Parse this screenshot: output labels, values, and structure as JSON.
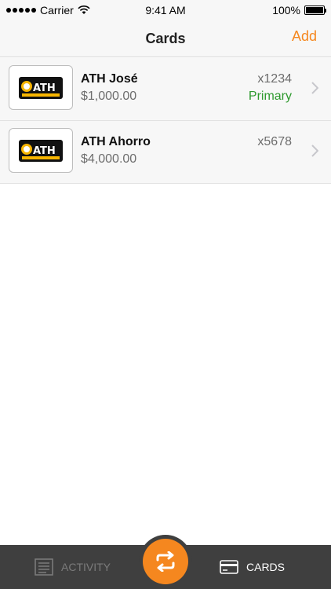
{
  "status_bar": {
    "carrier": "Carrier",
    "time": "9:41 AM",
    "battery": "100%"
  },
  "nav": {
    "title": "Cards",
    "add_label": "Add"
  },
  "cards": [
    {
      "logo_text": "ATH",
      "name": "ATH José",
      "amount": "$1,000.00",
      "number": "x1234",
      "tag": "Primary"
    },
    {
      "logo_text": "ATH",
      "name": "ATH Ahorro",
      "amount": "$4,000.00",
      "number": "x5678",
      "tag": ""
    }
  ],
  "tab_bar": {
    "activity_label": "ACTIVITY",
    "cards_label": "CARDS"
  },
  "colors": {
    "accent": "#f5871f",
    "primary_tag": "#2e9a2e",
    "tab_bar": "#3f3f3f"
  }
}
